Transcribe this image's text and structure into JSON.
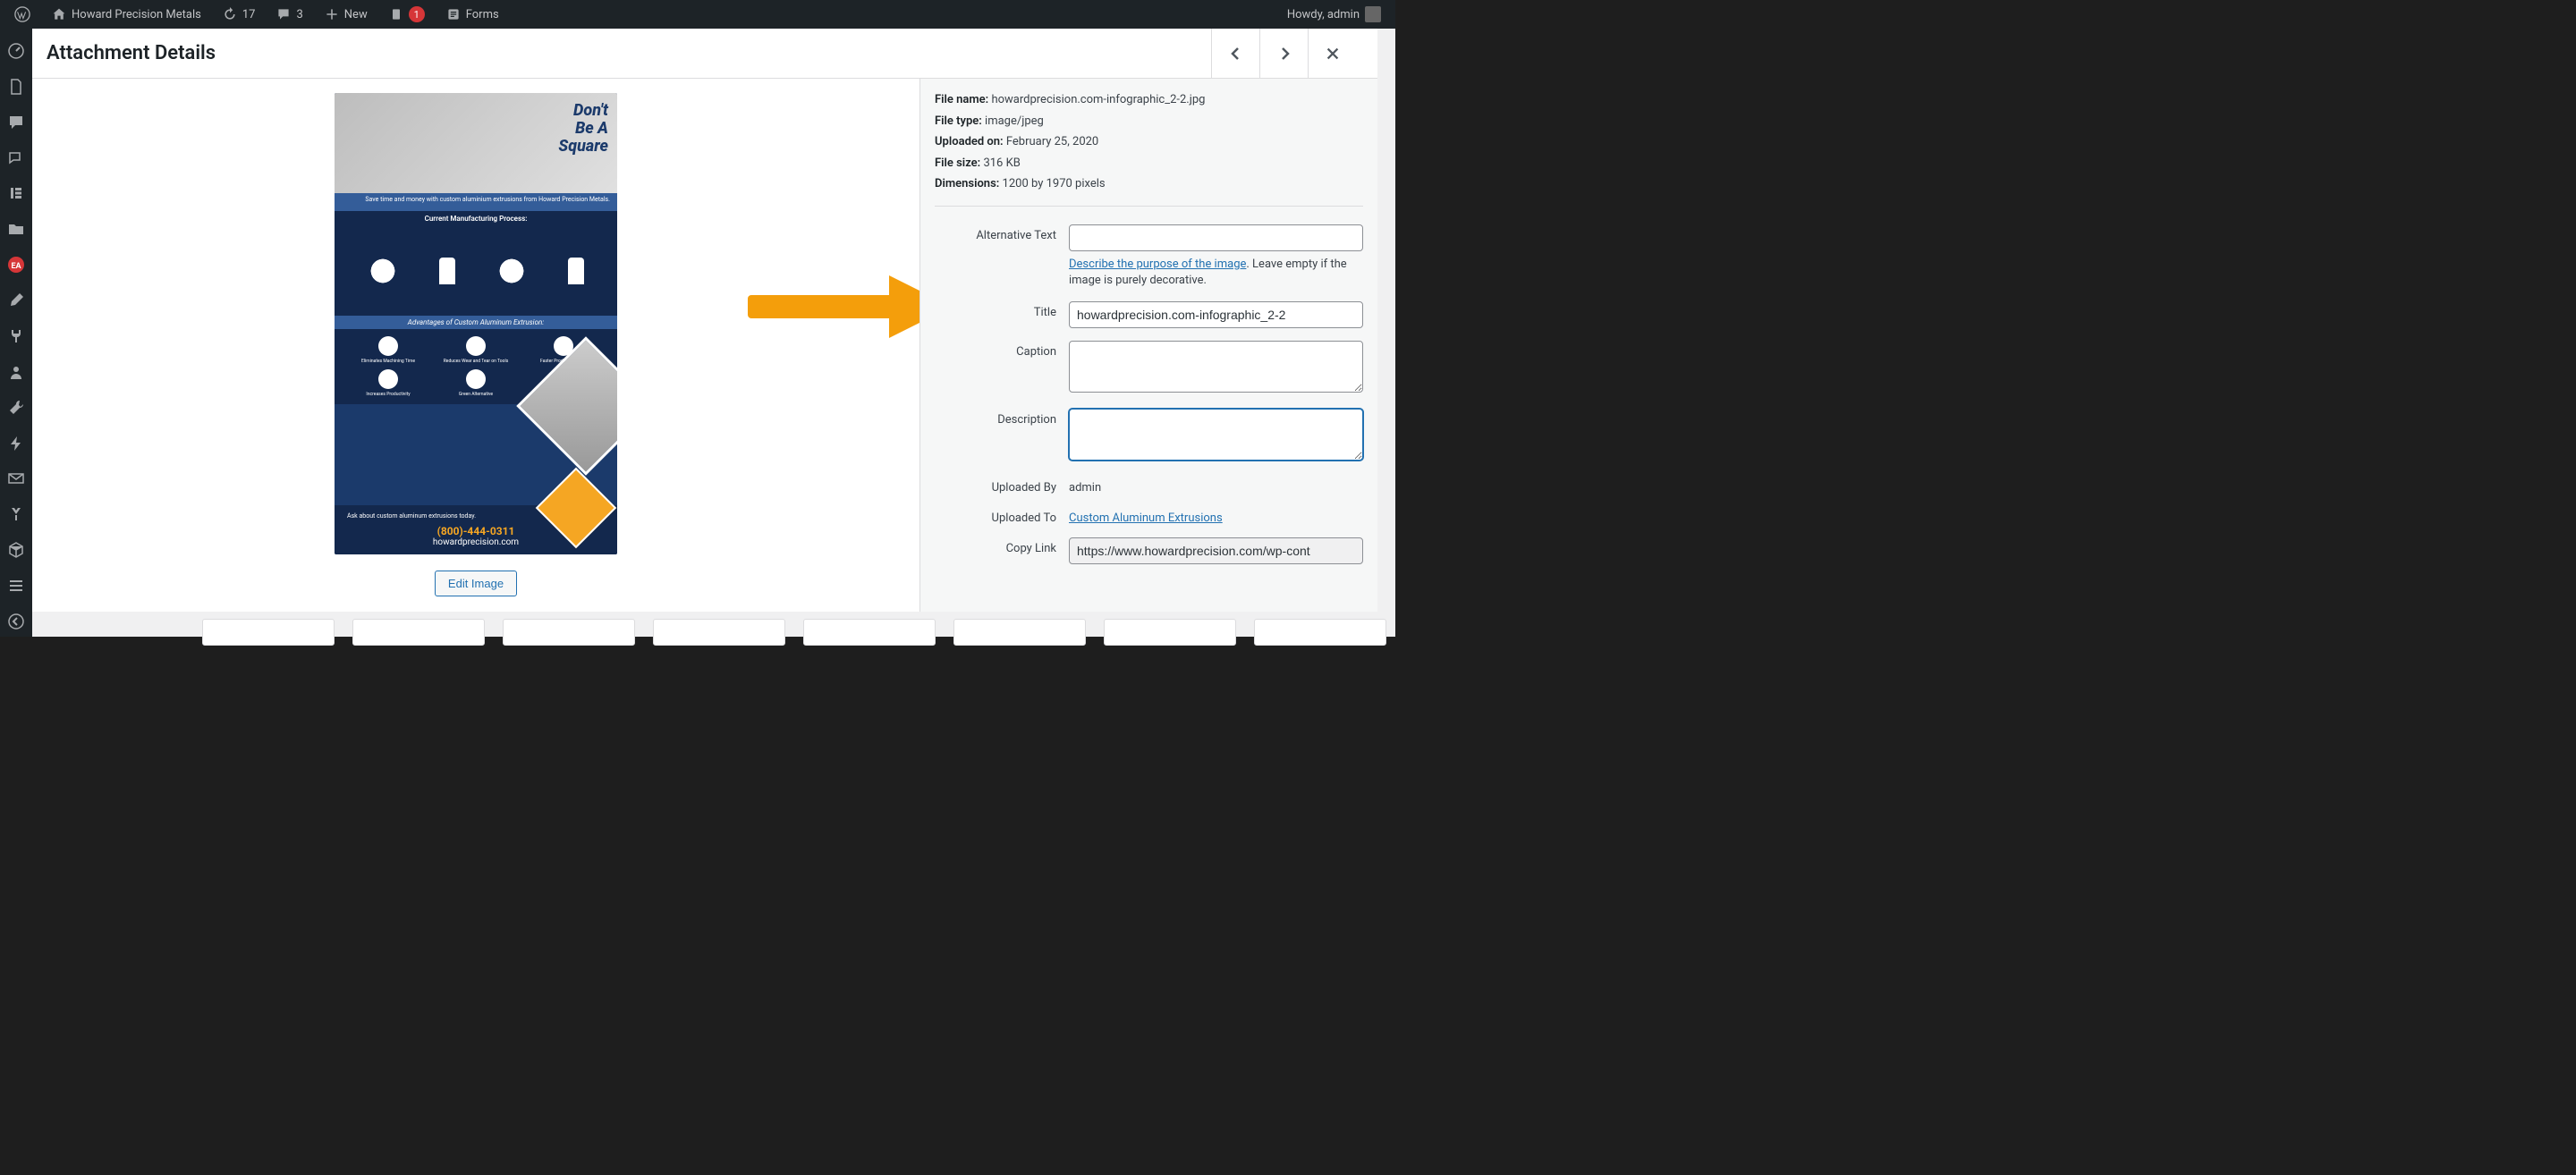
{
  "admin_bar": {
    "site_name": "Howard Precision Metals",
    "refresh_count": "17",
    "comments_count": "3",
    "new_label": "New",
    "alert_count": "1",
    "forms_label": "Forms",
    "howdy": "Howdy, admin"
  },
  "modal": {
    "title": "Attachment Details",
    "edit_image": "Edit Image"
  },
  "meta": {
    "file_name_label": "File name:",
    "file_name": "howardprecision.com-infographic_2-2.jpg",
    "file_type_label": "File type:",
    "file_type": "image/jpeg",
    "uploaded_on_label": "Uploaded on:",
    "uploaded_on": "February 25, 2020",
    "file_size_label": "File size:",
    "file_size": "316 KB",
    "dimensions_label": "Dimensions:",
    "dimensions": "1200 by 1970 pixels"
  },
  "fields": {
    "alt_text_label": "Alternative Text",
    "alt_text_value": "",
    "alt_help_link": "Describe the purpose of the image",
    "alt_help_suffix": ". Leave empty if the image is purely decorative.",
    "title_label": "Title",
    "title_value": "howardprecision.com-infographic_2-2",
    "caption_label": "Caption",
    "caption_value": "",
    "description_label": "Description",
    "description_value": "",
    "uploaded_by_label": "Uploaded By",
    "uploaded_by_value": "admin",
    "uploaded_to_label": "Uploaded To",
    "uploaded_to_value": "Custom Aluminum Extrusions",
    "copy_link_label": "Copy Link",
    "copy_link_value": "https://www.howardprecision.com/wp-cont"
  },
  "preview": {
    "heading_l1": "Don't",
    "heading_l2": "Be A",
    "heading_l3": "Square",
    "phone": "(800)-444-0311",
    "site_url": "howardprecision.com"
  }
}
